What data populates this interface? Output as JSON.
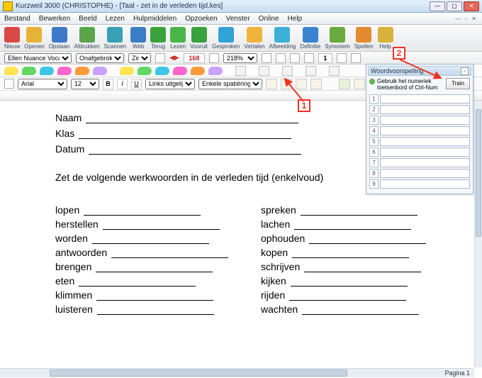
{
  "title": "Kurzweil 3000 (CHRISTOPHE) - [Taal - zet in de verleden tijd.kes]",
  "menu": [
    "Bestand",
    "Bewerken",
    "Beeld",
    "Lezen",
    "Hulpmiddelen",
    "Opzoeken",
    "Venster",
    "Online",
    "Help"
  ],
  "mainbuttons": [
    {
      "label": "Nieuw",
      "color": "#d94a46"
    },
    {
      "label": "Openen",
      "color": "#e7b238"
    },
    {
      "label": "Opslaan",
      "color": "#3d79c8"
    },
    {
      "label": "Afdrukken",
      "color": "#5aa54c"
    },
    {
      "label": "Scannen",
      "color": "#3aa0b5"
    },
    {
      "label": "Web",
      "color": "#3b7dc6"
    },
    {
      "label": "Terug",
      "color": "#39a23d"
    },
    {
      "label": "Lezen",
      "color": "#48b548"
    },
    {
      "label": "Vooruit",
      "color": "#39a23d"
    },
    {
      "label": "Gesproken",
      "color": "#33a2d7"
    },
    {
      "label": "Vertalen",
      "color": "#efb43c"
    },
    {
      "label": "Afbeelding",
      "color": "#3cb0d6"
    },
    {
      "label": "Definitie",
      "color": "#3983d0"
    },
    {
      "label": "Synoniem",
      "color": "#6aa93b"
    },
    {
      "label": "Spellen",
      "color": "#e48a30"
    },
    {
      "label": "Help",
      "color": "#d7b23c"
    }
  ],
  "sec": {
    "voice": "Ellen Nuance Voca",
    "style": "Onafgebroken",
    "zin": "Zin",
    "num": "168",
    "zoom": "218%",
    "pg": "1"
  },
  "highlighters": [
    "#ffe452",
    "#62d764",
    "#3fc6e7",
    "#ff66cc",
    "#ff9a3c",
    "#c9a1ff",
    "#ffe452",
    "#62d764",
    "#3fc6e7",
    "#ff66cc",
    "#ff9a3c",
    "#c9a1ff"
  ],
  "fontbar": {
    "font": "Arial",
    "size": "12",
    "bold": "B",
    "italic": "I",
    "under": "U",
    "align": "Links uitgelijnd",
    "spacing": "Enkele spatiëring"
  },
  "doc": {
    "labels": {
      "naam": "Naam",
      "klas": "Klas",
      "datum": "Datum"
    },
    "instr": "Zet de volgende werkwoorden in de verleden tijd (enkelvoud)",
    "left": [
      "lopen",
      "herstellen",
      "worden",
      "antwoorden",
      "brengen",
      "eten",
      "klimmen",
      "luisteren"
    ],
    "right": [
      "spreken",
      "lachen",
      "ophouden",
      "kopen",
      "schrijven",
      "kijken",
      "rijden",
      "wachten"
    ]
  },
  "panel": {
    "title": "Woordvoorspelling",
    "note": "Gebruik het numeriek toetsenbord of Ctrl-Num",
    "train": "Train",
    "rows": [
      "1",
      "2",
      "3",
      "4",
      "5",
      "6",
      "7",
      "8",
      "9"
    ]
  },
  "callouts": {
    "c1": "1",
    "c2": "2"
  },
  "status": {
    "page": "Pagina 1"
  }
}
